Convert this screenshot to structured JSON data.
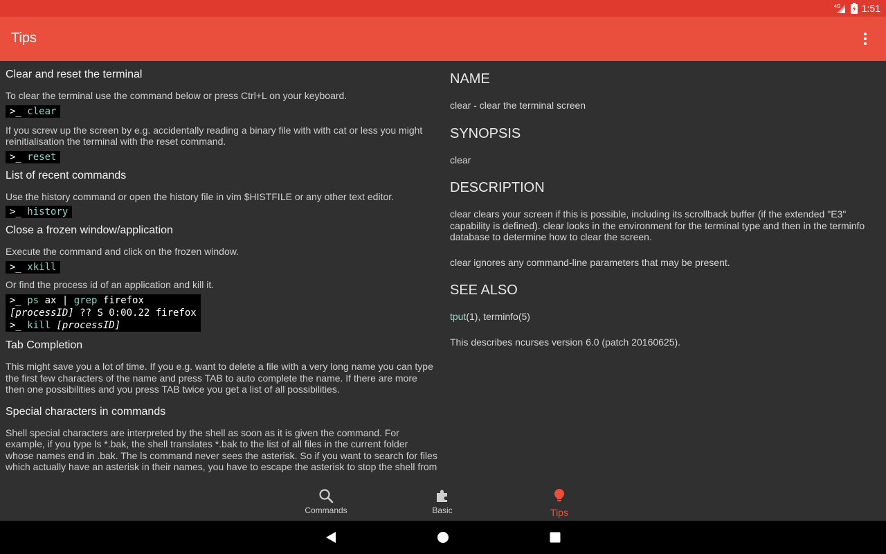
{
  "status": {
    "network": "4G",
    "time": "1:51"
  },
  "app_bar": {
    "title": "Tips"
  },
  "tips": {
    "s1_heading": "Clear and reset the terminal",
    "s1_text1": "To clear the terminal use the command below or press Ctrl+L on your keyboard.",
    "s1_cmd1": "clear",
    "s1_text2": "If you screw up the screen by e.g. accidentally reading a binary file with with cat or less you might reinitialisation the terminal with the reset command.",
    "s1_cmd2": "reset",
    "s2_heading": "List of recent commands",
    "s2_text": "Use the history command or open the history file in vim $HISTFILE or any other text editor.",
    "s2_cmd": "history",
    "s3_heading": "Close a frozen window/application",
    "s3_text1": "Execute the command and click on the frozen window.",
    "s3_cmd1": "xkill",
    "s3_text2": "Or find the process id of an application and kill it.",
    "s3_block_line1_cmd": "ps",
    "s3_block_line1_args": "ax |",
    "s3_block_line1_cmd2": "grep",
    "s3_block_line1_arg2": "firefox",
    "s3_block_line2_id": "[processID]",
    "s3_block_line2_rest": "?? S 0:00.22 firefox",
    "s3_block_line3_cmd": "kill",
    "s3_block_line3_id": "[processID]",
    "s4_heading": "Tab Completion",
    "s4_text": "This might save you a lot of time. If you e.g. want to delete a file with a very long name you can type the first few characters of the name and press TAB to auto complete the name. If there are more then one possibilities and you press TAB twice you get a list of all possibilities.",
    "s5_heading": "Special characters in commands",
    "s5_text": "Shell special characters are interpreted by the shell as soon as it is given the command. For example, if you type ls *.bak, the shell translates *.bak to the list of all files in the current folder whose names end in .bak. The ls command never sees the asterisk. So if you want to search for files which actually have an asterisk in their names, you have to escape the asterisk to stop the shell from",
    "prompt": ">_"
  },
  "man": {
    "name_heading": "NAME",
    "name_text": "clear - clear the terminal screen",
    "synopsis_heading": "SYNOPSIS",
    "synopsis_text": "clear",
    "description_heading": "DESCRIPTION",
    "description_p1": "clear clears your screen if this is possible, including its scrollback buffer (if the extended \"E3\" capability is defined). clear looks in the environment for the terminal type and then in the terminfo database to determine how to clear the screen.",
    "description_p2": "clear ignores any command-line parameters that may be present.",
    "see_also_heading": "SEE ALSO",
    "see_also_link": "tput",
    "see_also_rest": "(1), terminfo(5)",
    "version_text": "This describes ncurses version 6.0 (patch 20160625)."
  },
  "bottom_nav": {
    "items": [
      {
        "label": "Commands",
        "icon": "search-icon"
      },
      {
        "label": "Basic",
        "icon": "puzzle-icon"
      },
      {
        "label": "Tips",
        "icon": "lightbulb-icon"
      }
    ],
    "active": "Tips"
  },
  "colors": {
    "accent": "#ea4f3e",
    "status_bar": "#e03a2f",
    "background": "#303030",
    "command_highlight": "#8fd6c8"
  }
}
